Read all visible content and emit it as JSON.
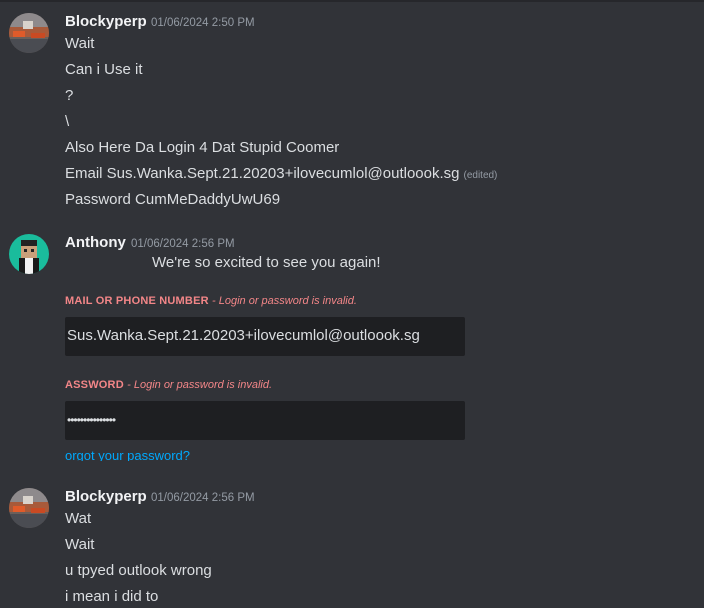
{
  "messages": [
    {
      "author": "Blockyperp",
      "timestamp": "01/06/2024 2:50 PM",
      "lines": [
        "Wait",
        "Can i Use it",
        "?",
        "\\",
        "Also Here Da Login 4 Dat Stupid Coomer",
        "Email Sus.Wanka.Sept.21.20203+ilovecumlol@outloook.sg",
        "Password CumMeDaddyUwU69"
      ],
      "edited_label": "(edited)"
    },
    {
      "author": "Anthony",
      "timestamp": "01/06/2024 2:56 PM",
      "embed": {
        "welcome_text": "We're so excited to see you again!",
        "email_label": "MAIL OR PHONE NUMBER",
        "email_error": "- Login or password is invalid.",
        "email_value": "Sus.Wanka.Sept.21.20203+ilovecumlol@outloook.sg",
        "password_label": "ASSWORD",
        "password_error": "- Login or password is invalid.",
        "password_value": "•••••••••••••••",
        "forgot_link": "orgot your password?"
      }
    },
    {
      "author": "Blockyperp",
      "timestamp": "01/06/2024 2:56 PM",
      "lines": [
        "Wat",
        "Wait",
        "u tpyed outlook wrong",
        "i mean i did to"
      ]
    }
  ],
  "colors": {
    "background": "#313338",
    "username": "#f2f3f5",
    "text": "#dbdee1",
    "timestamp": "#949ba4",
    "error_red": "#f38688",
    "link_blue": "#00a8fc",
    "input_bg": "#1e1f22"
  }
}
